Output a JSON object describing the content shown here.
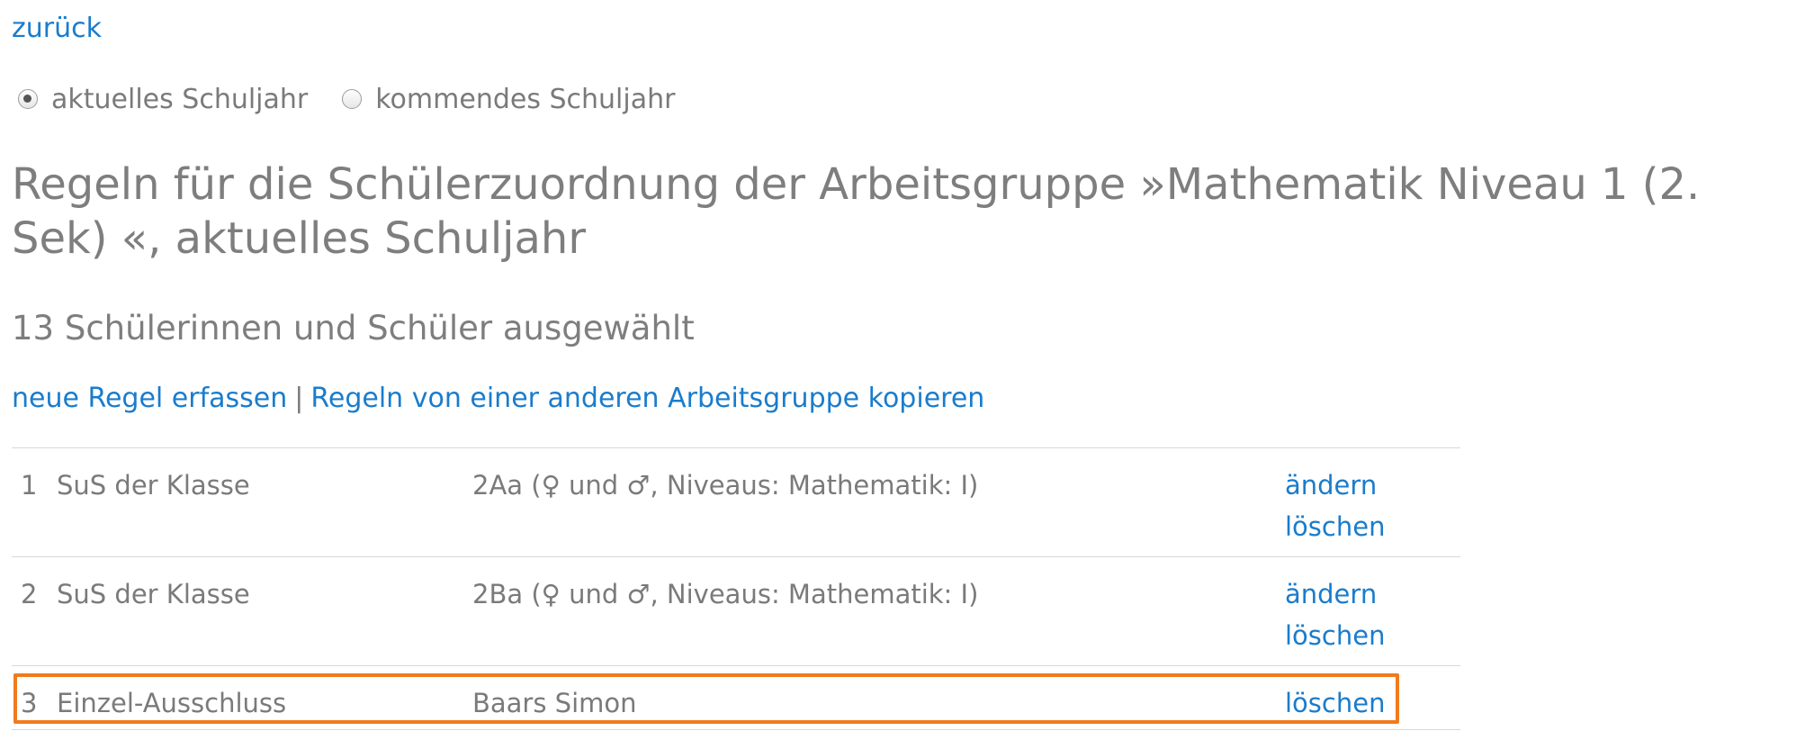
{
  "nav": {
    "back_label": "zurück"
  },
  "year_selector": {
    "options": [
      {
        "label": "aktuelles Schuljahr",
        "checked": true
      },
      {
        "label": "kommendes Schuljahr",
        "checked": false
      }
    ]
  },
  "page": {
    "title": "Regeln für die Schülerzuordnung der Arbeitsgruppe »Mathematik Niveau 1 (2. Sek) «, aktuelles Schuljahr",
    "selection_count": "13 Schülerinnen und Schüler ausgewählt"
  },
  "actions": {
    "new_rule": "neue Regel erfassen",
    "separator": "|",
    "copy_rules": "Regeln von einer anderen Arbeitsgruppe kopieren"
  },
  "rules": [
    {
      "num": "1",
      "type": "SuS der Klasse",
      "detail": "2Aa (♀ und ♂, Niveaus: Mathematik: I)",
      "edit_label": "ändern",
      "delete_label": "löschen"
    },
    {
      "num": "2",
      "type": "SuS der Klasse",
      "detail": "2Ba (♀ und ♂, Niveaus: Mathematik: I)",
      "edit_label": "ändern",
      "delete_label": "löschen"
    },
    {
      "num": "3",
      "type": "Einzel-Ausschluss",
      "detail": "Baars Simon",
      "delete_label": "löschen"
    }
  ],
  "colors": {
    "link": "#1a7ccc",
    "text": "#7a7a7a",
    "highlight": "#f07b1e",
    "divider": "#d8d8d8"
  }
}
